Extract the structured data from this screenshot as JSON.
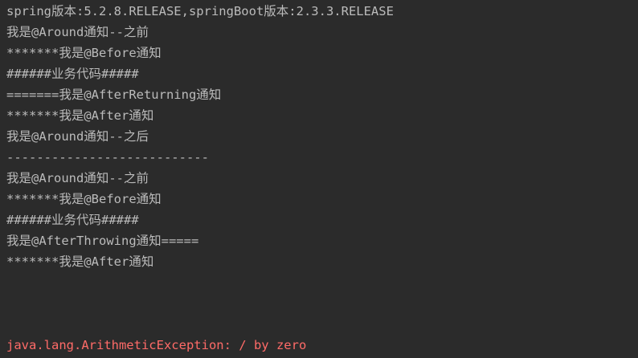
{
  "console": {
    "colors": {
      "background": "#2b2b2b",
      "text": "#bbbbbb",
      "error": "#ff6b68"
    },
    "lines": [
      "spring版本:5.2.8.RELEASE,springBoot版本:2.3.3.RELEASE",
      "我是@Around通知--之前",
      "*******我是@Before通知",
      "######业务代码#####",
      "=======我是@AfterReturning通知",
      "*******我是@After通知",
      "我是@Around通知--之后",
      "---------------------------",
      "我是@Around通知--之前",
      "*******我是@Before通知",
      "######业务代码#####",
      "我是@AfterThrowing通知=====",
      "*******我是@After通知"
    ],
    "error_line": "java.lang.ArithmeticException: / by zero"
  }
}
